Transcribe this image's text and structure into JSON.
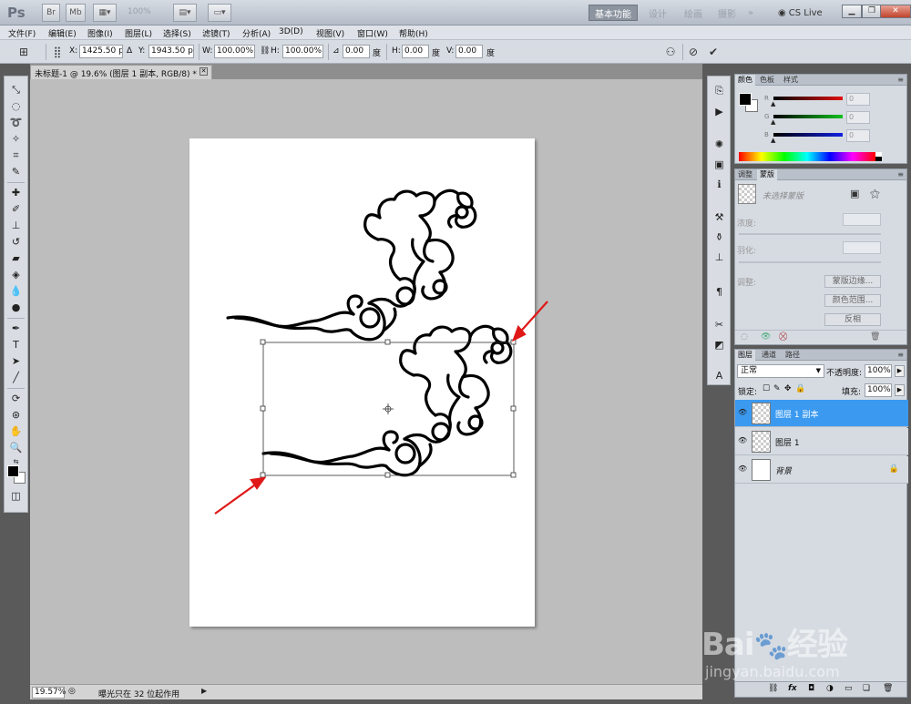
{
  "app": {
    "logo": "Ps",
    "zoom": "100%",
    "workspaces": [
      "基本功能",
      "设计",
      "绘画",
      "摄影"
    ],
    "more": "»",
    "cslive": "CS Live"
  },
  "menu": [
    "文件(F)",
    "编辑(E)",
    "图像(I)",
    "图层(L)",
    "选择(S)",
    "滤镜(T)",
    "分析(A)",
    "3D(D)",
    "视图(V)",
    "窗口(W)",
    "帮助(H)"
  ],
  "options": {
    "x_label": "X:",
    "x_value": "1425.50 px",
    "y_label": "Y:",
    "y_value": "1943.50 px",
    "w_label": "W:",
    "w_value": "100.00%",
    "h_label": "H:",
    "h_value": "100.00%",
    "angle_value": "0.00",
    "angle_unit": "度",
    "hskew_label": "H:",
    "hskew_value": "0.00",
    "hskew_unit": "度",
    "vskew_label": "V:",
    "vskew_value": "0.00",
    "vskew_unit": "度"
  },
  "document": {
    "tab_title": "未标题-1 @ 19.6% (图层 1 副本, RGB/8) *"
  },
  "status": {
    "zoom": "19.57%",
    "info": "曝光只在 32 位起作用"
  },
  "color_panel": {
    "tabs": [
      "颜色",
      "色板",
      "样式"
    ],
    "channels": [
      {
        "label": "R",
        "value": "0",
        "color": "#e01010"
      },
      {
        "label": "G",
        "value": "0",
        "color": "#10c020"
      },
      {
        "label": "B",
        "value": "0",
        "color": "#1020e0"
      }
    ]
  },
  "mask_panel": {
    "tabs": [
      "调整",
      "蒙版"
    ],
    "no_mask": "未选择蒙版",
    "density_label": "浓度:",
    "feather_label": "羽化:",
    "refine_label": "调整:",
    "btn_edge": "蒙版边缘...",
    "btn_range": "颜色范围...",
    "btn_invert": "反相"
  },
  "layers_panel": {
    "tabs": [
      "图层",
      "通道",
      "路径"
    ],
    "blend_mode": "正常",
    "opacity_label": "不透明度:",
    "opacity_value": "100%",
    "lock_label": "锁定:",
    "fill_label": "填充:",
    "fill_value": "100%",
    "layers": [
      {
        "name": "图层 1 副本",
        "selected": true
      },
      {
        "name": "图层 1",
        "selected": false
      },
      {
        "name": "背景",
        "selected": false
      }
    ],
    "footer_icons": [
      "link-icon",
      "fx-icon",
      "mask-icon",
      "adjustment-icon",
      "group-icon",
      "new-layer-icon",
      "trash-icon"
    ]
  },
  "watermark": {
    "logo": "Bai度经验",
    "url": "jingyan.baidu.com"
  },
  "colors": {
    "selection_blue": "#3b9af0",
    "annotation_red": "#e01818"
  }
}
